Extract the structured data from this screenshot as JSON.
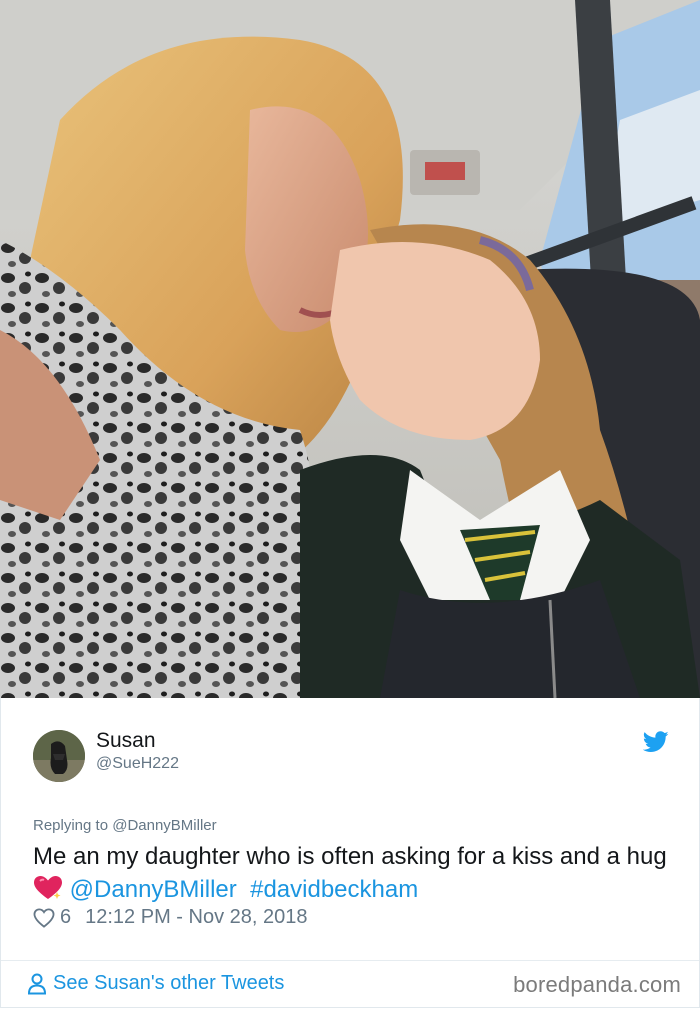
{
  "photo": {
    "alt_subject": "mother-kissing-daughter-selfie"
  },
  "tweet": {
    "author_name": "Susan",
    "author_handle": "@SueH222",
    "replying_prefix": "Replying to",
    "replying_to": "@DannyBMiller",
    "text_part1": "Me an my daughter who is often asking for a kiss and a hug",
    "mention": "@DannyBMiller",
    "hashtag": "#davidbeckham",
    "likes": "6",
    "timestamp": "12:12 PM - Nov 28, 2018",
    "see_more": "See Susan's other Tweets"
  },
  "watermark": "boredpanda.com",
  "colors": {
    "link": "#1b95e0",
    "muted": "#657786",
    "twitter_blue": "#1da1f2",
    "emoji_heart": "#e0245e"
  },
  "icons": {
    "bird": "twitter-bird-icon",
    "heart": "like-heart-icon",
    "person": "person-icon",
    "emoji": "sparkling-heart-emoji"
  }
}
